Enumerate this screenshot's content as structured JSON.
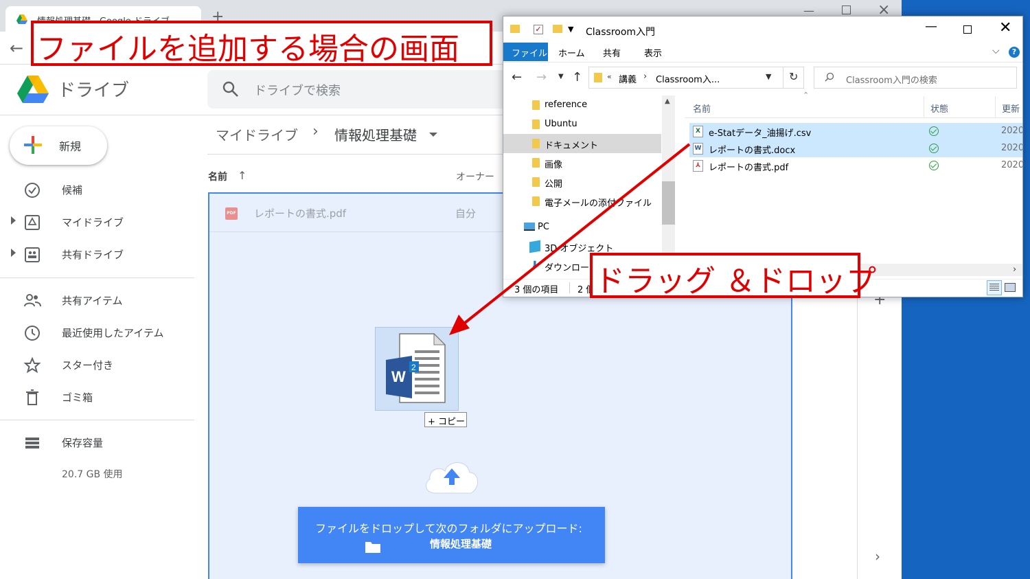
{
  "browser": {
    "tab_title": "情報処理基礎 - Google ドライブ",
    "new_tab": "+",
    "window_controls": {
      "minimize": "—",
      "close": "×"
    },
    "back": "←"
  },
  "drive": {
    "app_name": "ドライブ",
    "search_placeholder": "ドライブで検索",
    "new_button": "新規",
    "nav": [
      {
        "label": "候補",
        "icon": "check-box-icon"
      },
      {
        "label": "マイドライブ",
        "icon": "my-drive-icon"
      },
      {
        "label": "共有ドライブ",
        "icon": "shared-drives-icon"
      },
      {
        "label": "共有アイテム",
        "icon": "people-icon"
      },
      {
        "label": "最近使用したアイテム",
        "icon": "clock-icon"
      },
      {
        "label": "スター付き",
        "icon": "star-icon"
      },
      {
        "label": "ゴミ箱",
        "icon": "trash-icon"
      },
      {
        "label": "保存容量",
        "icon": "storage-icon"
      }
    ],
    "storage_used": "20.7 GB 使用",
    "breadcrumb": {
      "root": "マイドライブ",
      "separator": "›",
      "current": "情報処理基礎"
    },
    "columns": {
      "name": "名前",
      "sort_arrow": "↑",
      "owner": "オーナー"
    },
    "files": [
      {
        "name": "レポートの書式.pdf",
        "owner": "自分",
        "icon_text": "PDF"
      }
    ],
    "right_panel": {
      "add": "+",
      "expand": "›"
    },
    "drag": {
      "copy_badge": "+ コピー",
      "badge_number": "2",
      "word_letter": "W"
    },
    "upload": {
      "line1": "ファイルをドロップして次のフォルダにアップロード:",
      "folder": "情報処理基礎"
    }
  },
  "explorer": {
    "title": "Classroom入門",
    "window_controls": {
      "minimize": "—",
      "close": "✕"
    },
    "ribbon_tabs": [
      "ファイル",
      "ホーム",
      "共有",
      "表示"
    ],
    "ribbon_help": "?",
    "path": {
      "prefix": "«",
      "segments": [
        "講義",
        "Classroom入..."
      ],
      "separator": "›"
    },
    "search_placeholder": "Classroom入門の検索",
    "tree": [
      {
        "label": "reference"
      },
      {
        "label": "Ubuntu"
      },
      {
        "label": "ドキュメント"
      },
      {
        "label": "画像"
      },
      {
        "label": "公開"
      },
      {
        "label": "電子メールの添付ファイル"
      },
      {
        "label": "PC"
      },
      {
        "label": "3D オブジェクト"
      },
      {
        "label": "ダウンロード"
      }
    ],
    "columns": {
      "name": "名前",
      "status": "状態",
      "date": "更新"
    },
    "files": [
      {
        "name": "e-Statデータ_油揚げ.csv",
        "type_letter": "X",
        "type_color": "#1e7145",
        "date": "2020",
        "selected": true
      },
      {
        "name": "レポートの書式.docx",
        "type_letter": "W",
        "type_color": "#2b579a",
        "date": "2020",
        "selected": true
      },
      {
        "name": "レポートの書式.pdf",
        "type_letter": "⅄",
        "type_color": "#d32f2f",
        "date": "2020",
        "selected": false
      }
    ],
    "status_count": "3 個の項目",
    "status_selected": "2 個"
  },
  "annotations": {
    "title": "ファイルを追加する場合の画面",
    "drag_drop": "ドラッグ ＆ドロップ",
    "color": "#e00000"
  }
}
